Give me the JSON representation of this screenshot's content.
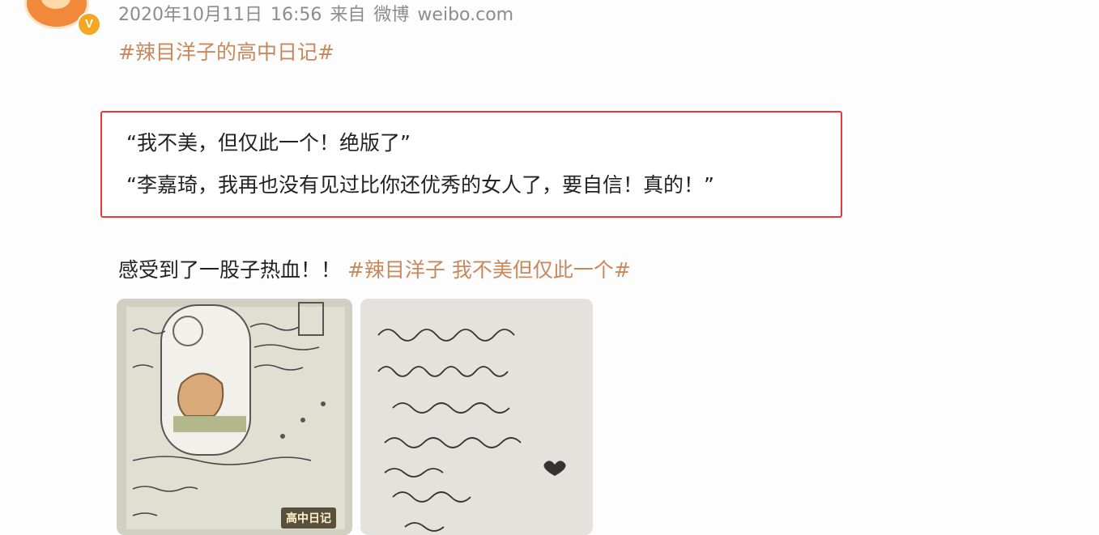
{
  "post": {
    "meta": {
      "date": "2020年10月11日",
      "time": "16:56",
      "source_prefix": "来自",
      "source_app": "微博",
      "source_site": "weibo.com"
    },
    "verified_badge": "V",
    "top_hashtag": "#辣目洋子的高中日记#",
    "highlight_quotes": [
      "“我不美，但仅此一个！绝版了”",
      "“李嘉琦，我再也没有见过比你还优秀的女人了，要自信！真的！”"
    ],
    "body_text": "感受到了一股子热血！！",
    "body_hashtag": "#辣目洋子 我不美但仅此一个#",
    "images": [
      {
        "stamp": "高中日记"
      },
      {
        "stamp": ""
      }
    ]
  },
  "colors": {
    "hashtag": "#c9885c",
    "highlight_border": "#e33b3b",
    "meta_text": "#8c8c8c",
    "badge": "#f5a623"
  },
  "icons": [
    "avatar",
    "verified-badge-icon"
  ]
}
